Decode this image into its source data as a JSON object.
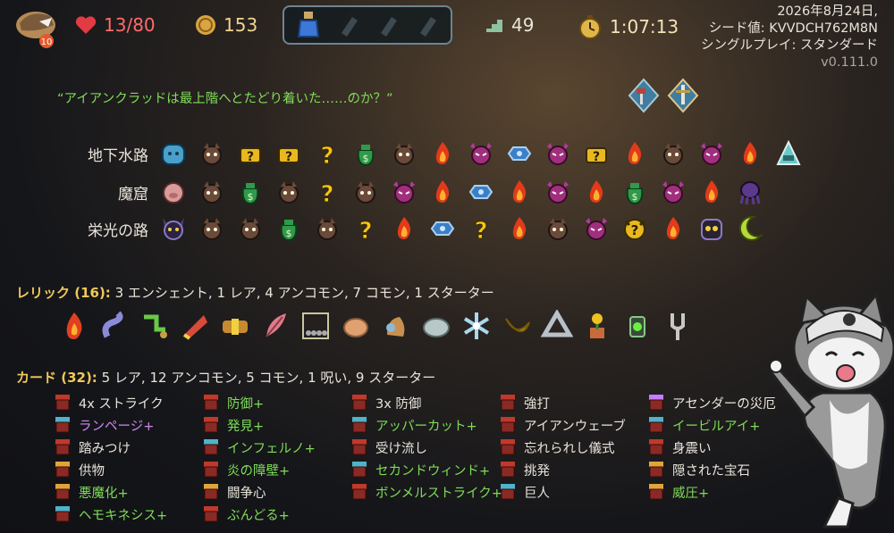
{
  "topbar": {
    "character": {
      "ascension": "10"
    },
    "hp": "13/80",
    "gold": "153",
    "floor": "49",
    "time": "1:07:13",
    "potions": [
      "blue-flask-potion-icon",
      "empty-potion-slot",
      "empty-potion-slot",
      "empty-potion-slot"
    ]
  },
  "run_info": {
    "date": "2026年8月24日,",
    "seed": "シード値: KVVDCH762M8N",
    "mode": "シングルプレイ: スタンダード",
    "version": "v0.111.0"
  },
  "quote": "“アイアンクラッドは最上階へとたどり着いた……のか？”",
  "boss_relics": [
    "hammer-shield-icon",
    "sword-shield-icon"
  ],
  "acts": [
    {
      "name": "地下水路",
      "nodes": [
        "ancient",
        "monster",
        "unknown-chest",
        "unknown-chest",
        "unknown",
        "merchant",
        "monster",
        "rest",
        "elite",
        "treasure",
        "elite",
        "unknown-chest",
        "rest",
        "monster",
        "elite",
        "rest",
        "boss-cloak"
      ]
    },
    {
      "name": "魔窟",
      "nodes": [
        "ancient-pig",
        "monster",
        "merchant",
        "monster",
        "unknown",
        "monster",
        "elite",
        "rest",
        "treasure",
        "rest",
        "elite",
        "rest",
        "merchant",
        "elite",
        "rest",
        "boss-squid"
      ]
    },
    {
      "name": "栄光の路",
      "nodes": [
        "ancient-demon",
        "monster",
        "monster",
        "merchant",
        "monster",
        "unknown",
        "rest",
        "treasure",
        "unknown",
        "rest",
        "monster",
        "elite",
        "unknown-demon",
        "rest",
        "boss-bot",
        "boss-moon"
      ]
    }
  ],
  "relics_section": {
    "label": "レリック (16):",
    "summary": "3 エンシェント, 1 レア, 4 アンコモン, 7 コモン, 1 スターター",
    "items": [
      "burning-blood-icon",
      "snake-icon",
      "pipe-icon",
      "horn-icon",
      "belt-icon",
      "feather-icon",
      "newtons-cradle-icon",
      "hand-icon",
      "bell-icon",
      "stone-icon",
      "snowflake-icon",
      "banana-icon",
      "trefoil-icon",
      "flower-pot-icon",
      "lantern-icon",
      "tuning-fork-icon"
    ]
  },
  "cards_section": {
    "label": "カード (32):",
    "summary": "5 レア, 12 アンコモン, 5 コモン, 1 呪い, 9 スターター",
    "columns": [
      [
        {
          "name": "4x ストライク",
          "color": "white",
          "rarity": "#c0392b"
        },
        {
          "name": "ランページ+",
          "color": "purple",
          "rarity": "#4fb3c9"
        },
        {
          "name": "踏みつけ",
          "color": "white",
          "rarity": "#c0392b"
        },
        {
          "name": "供物",
          "color": "white",
          "rarity": "#e0a53a"
        },
        {
          "name": "悪魔化+",
          "color": "green",
          "rarity": "#e0a53a"
        },
        {
          "name": "ヘモキネシス+",
          "color": "green",
          "rarity": "#4fb3c9"
        }
      ],
      [
        {
          "name": "防御+",
          "color": "green",
          "rarity": "#c0392b"
        },
        {
          "name": "発見+",
          "color": "green",
          "rarity": "#c0392b"
        },
        {
          "name": "インフェルノ+",
          "color": "green",
          "rarity": "#4fb3c9"
        },
        {
          "name": "炎の障壁+",
          "color": "green",
          "rarity": "#c0392b"
        },
        {
          "name": "闘争心",
          "color": "white",
          "rarity": "#e0a53a"
        },
        {
          "name": "ぶんどる+",
          "color": "green",
          "rarity": "#c0392b"
        }
      ],
      [
        {
          "name": "3x 防御",
          "color": "white",
          "rarity": "#c0392b"
        },
        {
          "name": "アッパーカット+",
          "color": "green",
          "rarity": "#4fb3c9"
        },
        {
          "name": "受け流し",
          "color": "white",
          "rarity": "#c0392b"
        },
        {
          "name": "セカンドウィンド+",
          "color": "green",
          "rarity": "#4fb3c9"
        },
        {
          "name": "ボンメルストライク+",
          "color": "green",
          "rarity": "#c0392b"
        }
      ],
      [
        {
          "name": "強打",
          "color": "white",
          "rarity": "#c0392b"
        },
        {
          "name": "アイアンウェーブ",
          "color": "white",
          "rarity": "#c0392b"
        },
        {
          "name": "忘れられし儀式",
          "color": "white",
          "rarity": "#c0392b"
        },
        {
          "name": "挑発",
          "color": "white",
          "rarity": "#c0392b"
        },
        {
          "name": "巨人",
          "color": "white",
          "rarity": "#4fb3c9"
        }
      ],
      [
        {
          "name": "アセンダーの災厄",
          "color": "white",
          "rarity": "#c77dff"
        },
        {
          "name": "イービルアイ+",
          "color": "green",
          "rarity": "#4fb3c9"
        },
        {
          "name": "身震い",
          "color": "white",
          "rarity": "#c0392b"
        },
        {
          "name": "隠された宝石",
          "color": "white",
          "rarity": "#e0a53a"
        },
        {
          "name": "威圧+",
          "color": "green",
          "rarity": "#e0a53a"
        }
      ]
    ]
  },
  "colors": {
    "accent": "#f1c85a",
    "green": "#7fdc58",
    "purple": "#cf88f0",
    "hp": "#ff6b6b"
  }
}
